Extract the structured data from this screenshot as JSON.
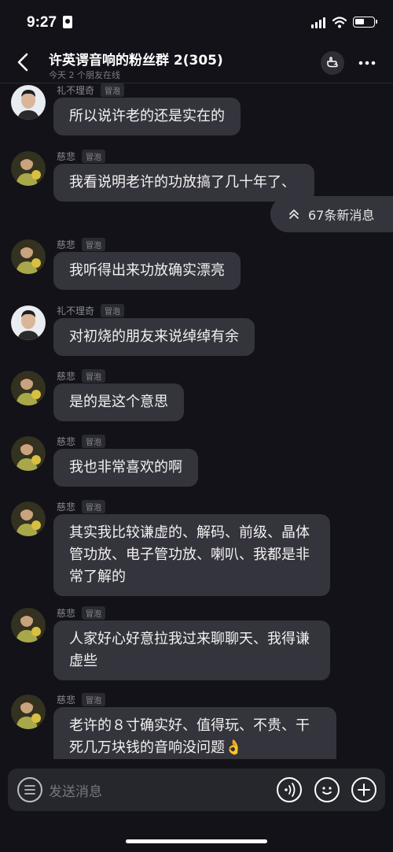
{
  "status_bar": {
    "time": "9:27"
  },
  "header": {
    "title": "许英谔音响的粉丝群 2(305)",
    "subtitle": "今天 2 个朋友在线"
  },
  "new_messages_label": "67条新消息",
  "messages": [
    {
      "sender": "礼不理奇",
      "tag": "冒泡",
      "text": "所以说许老的还是实在的"
    },
    {
      "sender": "慈悲",
      "tag": "冒泡",
      "text": "我看说明老许的功放搞了几十年了、"
    },
    {
      "sender": "慈悲",
      "tag": "冒泡",
      "text": "我听得出来功放确实漂亮"
    },
    {
      "sender": "礼不理奇",
      "tag": "冒泡",
      "text": "对初烧的朋友来说绰绰有余"
    },
    {
      "sender": "慈悲",
      "tag": "冒泡",
      "text": "是的是这个意思"
    },
    {
      "sender": "慈悲",
      "tag": "冒泡",
      "text": "我也非常喜欢的啊"
    },
    {
      "sender": "慈悲",
      "tag": "冒泡",
      "text": "其实我比较谦虚的、解码、前级、晶体管功放、电子管功放、喇叭、我都是非常了解的"
    },
    {
      "sender": "慈悲",
      "tag": "冒泡",
      "text": "人家好心好意拉我过来聊聊天、我得谦虚些"
    },
    {
      "sender": "慈悲",
      "tag": "冒泡",
      "text": "老许的８寸确实好、值得玩、不贵、干死几万块钱的音响没问题👌"
    }
  ],
  "input": {
    "placeholder": "发送消息"
  },
  "icons": {
    "back": "chevron-left-icon",
    "hand": "pointing-hand-icon",
    "more": "more-dots-icon",
    "new_messages": "double-chevron-up-icon",
    "list": "list-icon",
    "voice": "voice-icon",
    "emoji": "emoji-icon",
    "plus": "plus-icon"
  },
  "colors": {
    "background": "#121218",
    "bubble": "#34343c",
    "muted_text": "#8a8a94"
  }
}
